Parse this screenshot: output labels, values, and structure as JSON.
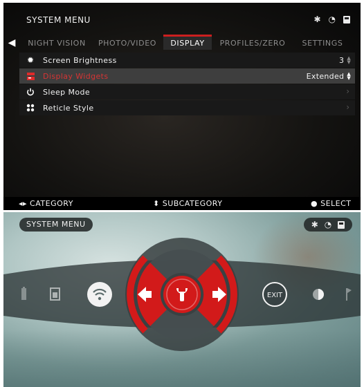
{
  "top_panel": {
    "title": "SYSTEM MENU",
    "status_icons": [
      "bluetooth-icon",
      "wifi-icon",
      "sd-card-icon"
    ],
    "tabs": [
      {
        "label": "NIGHT VISION",
        "active": false
      },
      {
        "label": "PHOTO/VIDEO",
        "active": false
      },
      {
        "label": "DISPLAY",
        "active": true
      },
      {
        "label": "PROFILES/ZERO",
        "active": false
      },
      {
        "label": "SETTINGS",
        "active": false
      }
    ],
    "menu_items": [
      {
        "icon": "brightness-icon",
        "label": "Screen Brightness",
        "value": "3",
        "control": "stepper"
      },
      {
        "icon": "widgets-icon",
        "label": "Display Widgets",
        "value": "Extended",
        "control": "stepper",
        "selected": true
      },
      {
        "icon": "power-icon",
        "label": "Sleep Mode",
        "control": "chevron"
      },
      {
        "icon": "reticle-icon",
        "label": "Reticle Style",
        "control": "chevron"
      }
    ],
    "footer": {
      "category": "CATEGORY",
      "subcategory": "SUBCATEGORY",
      "select": "SELECT"
    },
    "accent_color": "#cc1f1f"
  },
  "bottom_panel": {
    "title": "SYSTEM MENU",
    "status_icons": [
      "bluetooth-icon",
      "wifi-icon",
      "sd-card-icon"
    ],
    "carousel_icons": [
      "battery-icon",
      "gallery-icon",
      "wifi-icon",
      "exit-icon",
      "contrast-icon",
      "flag-icon"
    ],
    "exit_label": "EXIT",
    "center_icon": "wrench-icon",
    "accent_color": "#d21a1a"
  }
}
